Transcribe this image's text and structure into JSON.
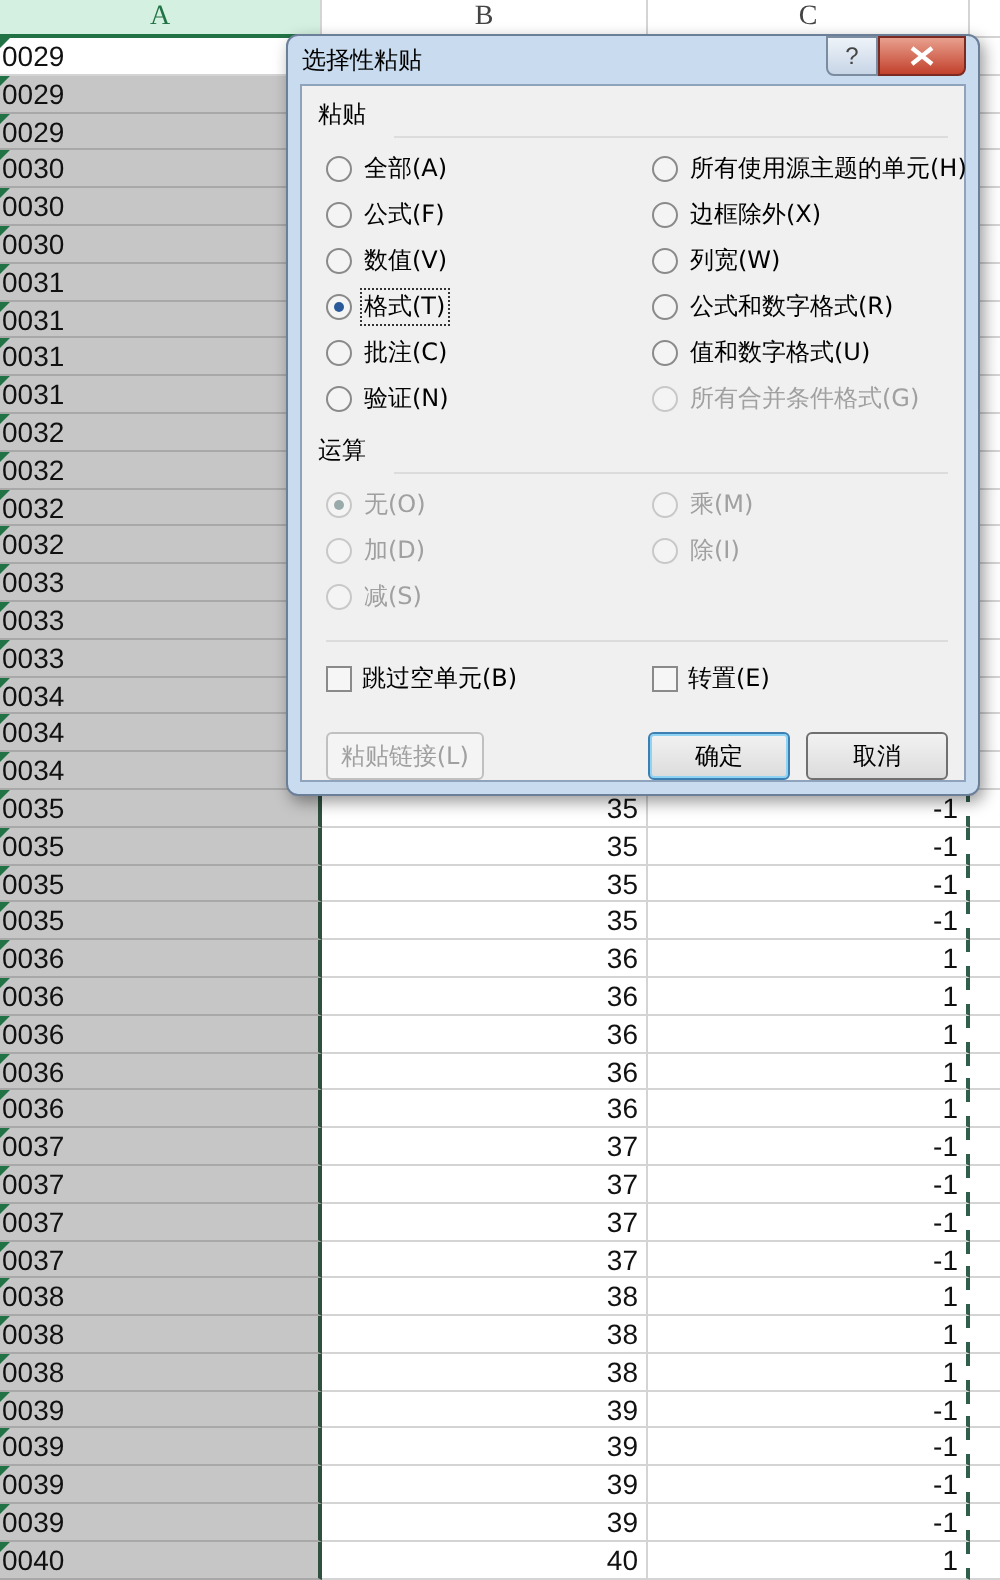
{
  "columns": [
    {
      "label": "A",
      "selected": true
    },
    {
      "label": "B",
      "selected": false
    },
    {
      "label": "C",
      "selected": false
    }
  ],
  "rows": [
    {
      "a": "0029",
      "active": true
    },
    {
      "a": "0029",
      "active": false
    },
    {
      "a": "0029",
      "active": false
    },
    {
      "a": "0030",
      "active": false
    },
    {
      "a": "0030",
      "active": false
    },
    {
      "a": "0030",
      "active": false
    },
    {
      "a": "0031",
      "active": false
    },
    {
      "a": "0031",
      "active": false
    },
    {
      "a": "0031",
      "active": false
    },
    {
      "a": "0031",
      "active": false
    },
    {
      "a": "0032",
      "active": false
    },
    {
      "a": "0032",
      "active": false
    },
    {
      "a": "0032",
      "active": false
    },
    {
      "a": "0032",
      "active": false
    },
    {
      "a": "0033",
      "active": false
    },
    {
      "a": "0033",
      "active": false
    },
    {
      "a": "0033",
      "active": false
    },
    {
      "a": "0034",
      "active": false
    },
    {
      "a": "0034",
      "active": false
    },
    {
      "a": "0034",
      "active": false
    },
    {
      "a": "0035",
      "active": false,
      "b": "35",
      "c": "-1"
    },
    {
      "a": "0035",
      "active": false,
      "b": "35",
      "c": "-1"
    },
    {
      "a": "0035",
      "active": false,
      "b": "35",
      "c": "-1"
    },
    {
      "a": "0035",
      "active": false,
      "b": "35",
      "c": "-1"
    },
    {
      "a": "0036",
      "active": false,
      "b": "36",
      "c": "1"
    },
    {
      "a": "0036",
      "active": false,
      "b": "36",
      "c": "1"
    },
    {
      "a": "0036",
      "active": false,
      "b": "36",
      "c": "1"
    },
    {
      "a": "0036",
      "active": false,
      "b": "36",
      "c": "1"
    },
    {
      "a": "0036",
      "active": false,
      "b": "36",
      "c": "1"
    },
    {
      "a": "0037",
      "active": false,
      "b": "37",
      "c": "-1"
    },
    {
      "a": "0037",
      "active": false,
      "b": "37",
      "c": "-1"
    },
    {
      "a": "0037",
      "active": false,
      "b": "37",
      "c": "-1"
    },
    {
      "a": "0037",
      "active": false,
      "b": "37",
      "c": "-1"
    },
    {
      "a": "0038",
      "active": false,
      "b": "38",
      "c": "1"
    },
    {
      "a": "0038",
      "active": false,
      "b": "38",
      "c": "1"
    },
    {
      "a": "0038",
      "active": false,
      "b": "38",
      "c": "1"
    },
    {
      "a": "0039",
      "active": false,
      "b": "39",
      "c": "-1"
    },
    {
      "a": "0039",
      "active": false,
      "b": "39",
      "c": "-1"
    },
    {
      "a": "0039",
      "active": false,
      "b": "39",
      "c": "-1"
    },
    {
      "a": "0039",
      "active": false,
      "b": "39",
      "c": "-1"
    },
    {
      "a": "0040",
      "active": false,
      "b": "40",
      "c": "1"
    }
  ],
  "dialog": {
    "title": "选择性粘贴",
    "help_button": "?",
    "paste": {
      "label": "粘贴",
      "options": [
        {
          "label": "全部(A)",
          "selected": false,
          "disabled": false
        },
        {
          "label": "所有使用源主题的单元(H)",
          "selected": false,
          "disabled": false
        },
        {
          "label": "公式(F)",
          "selected": false,
          "disabled": false
        },
        {
          "label": "边框除外(X)",
          "selected": false,
          "disabled": false
        },
        {
          "label": "数值(V)",
          "selected": false,
          "disabled": false
        },
        {
          "label": "列宽(W)",
          "selected": false,
          "disabled": false
        },
        {
          "label": "格式(T)",
          "selected": true,
          "disabled": false
        },
        {
          "label": "公式和数字格式(R)",
          "selected": false,
          "disabled": false
        },
        {
          "label": "批注(C)",
          "selected": false,
          "disabled": false
        },
        {
          "label": "值和数字格式(U)",
          "selected": false,
          "disabled": false
        },
        {
          "label": "验证(N)",
          "selected": false,
          "disabled": false
        },
        {
          "label": "所有合并条件格式(G)",
          "selected": false,
          "disabled": true
        }
      ]
    },
    "operation": {
      "label": "运算",
      "options": [
        {
          "label": "无(O)",
          "selected": true,
          "disabled": true
        },
        {
          "label": "乘(M)",
          "selected": false,
          "disabled": true
        },
        {
          "label": "加(D)",
          "selected": false,
          "disabled": true
        },
        {
          "label": "除(I)",
          "selected": false,
          "disabled": true
        },
        {
          "label": "减(S)",
          "selected": false,
          "disabled": true
        }
      ]
    },
    "checkboxes": [
      {
        "label": "跳过空单元(B)",
        "checked": false
      },
      {
        "label": "转置(E)",
        "checked": false
      }
    ],
    "buttons": [
      {
        "label": "粘贴链接(L)",
        "kind": "link",
        "disabled": true
      },
      {
        "label": "确定",
        "kind": "default",
        "disabled": false
      },
      {
        "label": "取消",
        "kind": "normal",
        "disabled": false
      }
    ]
  }
}
